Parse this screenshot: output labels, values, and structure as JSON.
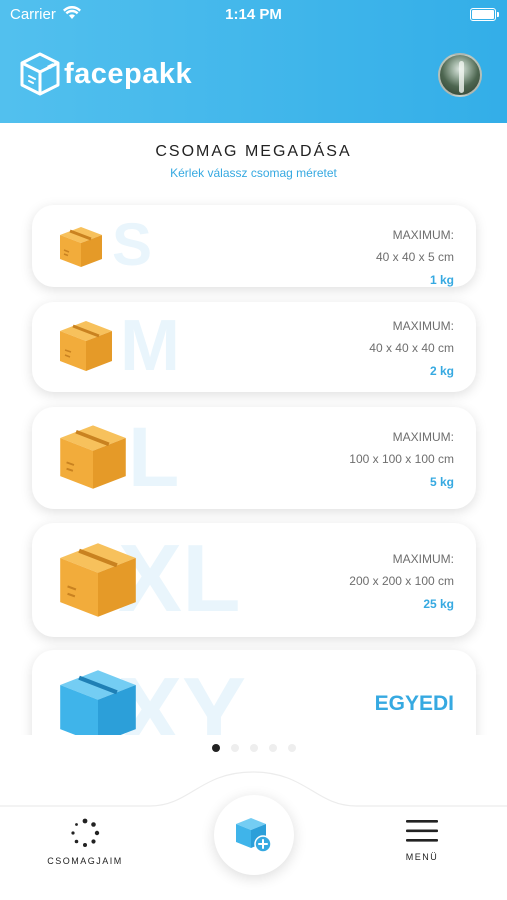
{
  "status_bar": {
    "carrier": "Carrier",
    "time": "1:14 PM"
  },
  "header": {
    "brand": "facepakk"
  },
  "page": {
    "title": "CSOMAG MEGADÁSA",
    "subtitle": "Kérlek válassz csomag méretet"
  },
  "packages": [
    {
      "size": "S",
      "max_label": "MAXIMUM:",
      "dimensions": "40 x 40 x 5 cm",
      "weight": "1 kg"
    },
    {
      "size": "M",
      "max_label": "MAXIMUM:",
      "dimensions": "40 x 40 x 40 cm",
      "weight": "2 kg"
    },
    {
      "size": "L",
      "max_label": "MAXIMUM:",
      "dimensions": "100 x 100 x 100 cm",
      "weight": "5 kg"
    },
    {
      "size": "XL",
      "max_label": "MAXIMUM:",
      "dimensions": "200 x 200 x 100 cm",
      "weight": "25 kg"
    },
    {
      "size": "XY",
      "custom_label": "EGYEDI"
    }
  ],
  "pager": {
    "pages": 5,
    "active": 1
  },
  "tabbar": {
    "left_label": "CSOMAGJAIM",
    "right_label": "MENÜ"
  },
  "colors": {
    "accent": "#36a9e1",
    "box_orange": "#f2ac3b",
    "box_blue": "#3fb4ea"
  }
}
